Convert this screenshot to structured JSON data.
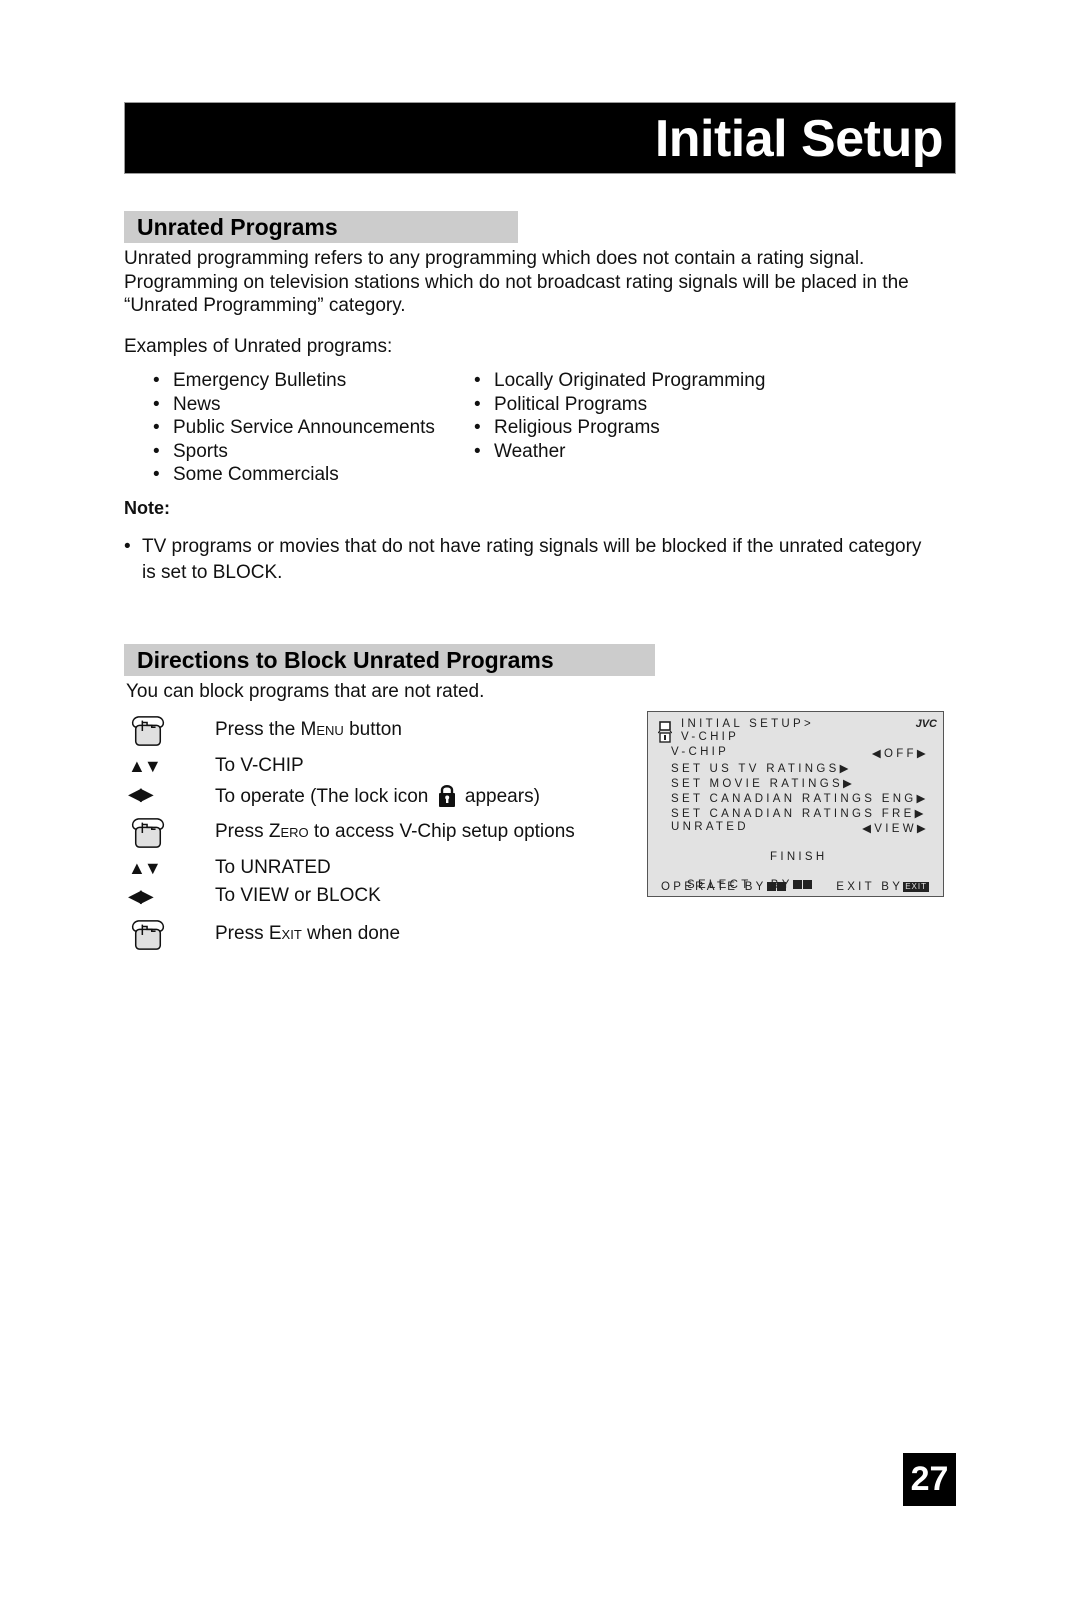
{
  "header": {
    "title": "Initial Setup"
  },
  "section_unrated": {
    "heading": "Unrated Programs",
    "paragraph_lines": [
      "Unrated programming refers to any programming which does not contain a rating signal.",
      "Programming on television stations which do not broadcast rating signals will be placed in the",
      "“Unrated Programming” category."
    ],
    "examples_intro": "Examples of Unrated programs:",
    "examples_left": [
      "Emergency Bulletins",
      "News",
      "Public Service Announcements",
      "Sports",
      "Some Commercials"
    ],
    "examples_right": [
      "Locally Originated Programming",
      "Political Programs",
      "Religious Programs",
      "Weather"
    ],
    "note_label": "Note:",
    "note_lines": [
      "TV programs or movies that do not have rating signals will be blocked if the unrated category",
      "is set to BLOCK."
    ]
  },
  "section_directions": {
    "heading": "Directions to Block Unrated Programs",
    "intro": "You can block programs that are not rated.",
    "steps": [
      {
        "icon": "hand-press-icon",
        "pre": "Press the ",
        "key": "Menu",
        "post": " button"
      },
      {
        "icon": "up-down-arrows-icon",
        "glyph": "▲▼",
        "text": "To V-CHIP"
      },
      {
        "icon": "left-right-arrows-icon",
        "glyph": "◀▶",
        "pre": "To operate (The lock icon",
        "post": "appears)"
      },
      {
        "icon": "hand-press-icon",
        "pre": "Press ",
        "key": "Zero",
        "post": " to access V-Chip setup options"
      },
      {
        "icon": "up-down-arrows-icon",
        "glyph": "▲▼",
        "text": "To UNRATED"
      },
      {
        "icon": "left-right-arrows-icon",
        "glyph": "◀▶",
        "text": "To VIEW or BLOCK"
      },
      {
        "icon": "hand-press-icon",
        "pre": "Press ",
        "key": "Exit",
        "post": " when done"
      }
    ]
  },
  "osd": {
    "breadcrumb_1": "INITIAL SETUP>",
    "breadcrumb_2": "V-CHIP",
    "brand": "JVC",
    "items": [
      {
        "label": "V-CHIP",
        "value": "◀OFF▶"
      },
      {
        "label": "SET US TV RATINGS▶",
        "value": ""
      },
      {
        "label": "SET MOVIE RATINGS▶",
        "value": ""
      },
      {
        "label": "SET CANADIAN RATINGS ENG▶",
        "value": ""
      },
      {
        "label": "SET CANADIAN RATINGS FRE▶",
        "value": ""
      },
      {
        "label": "UNRATED",
        "value": "◀VIEW▶"
      }
    ],
    "finish": "FINISH",
    "select_by": "SELECT   BY",
    "operate_by": "OPERATE BY",
    "exit_by": "EXIT BY",
    "exit_key": "EXIT"
  },
  "page_number": "27"
}
